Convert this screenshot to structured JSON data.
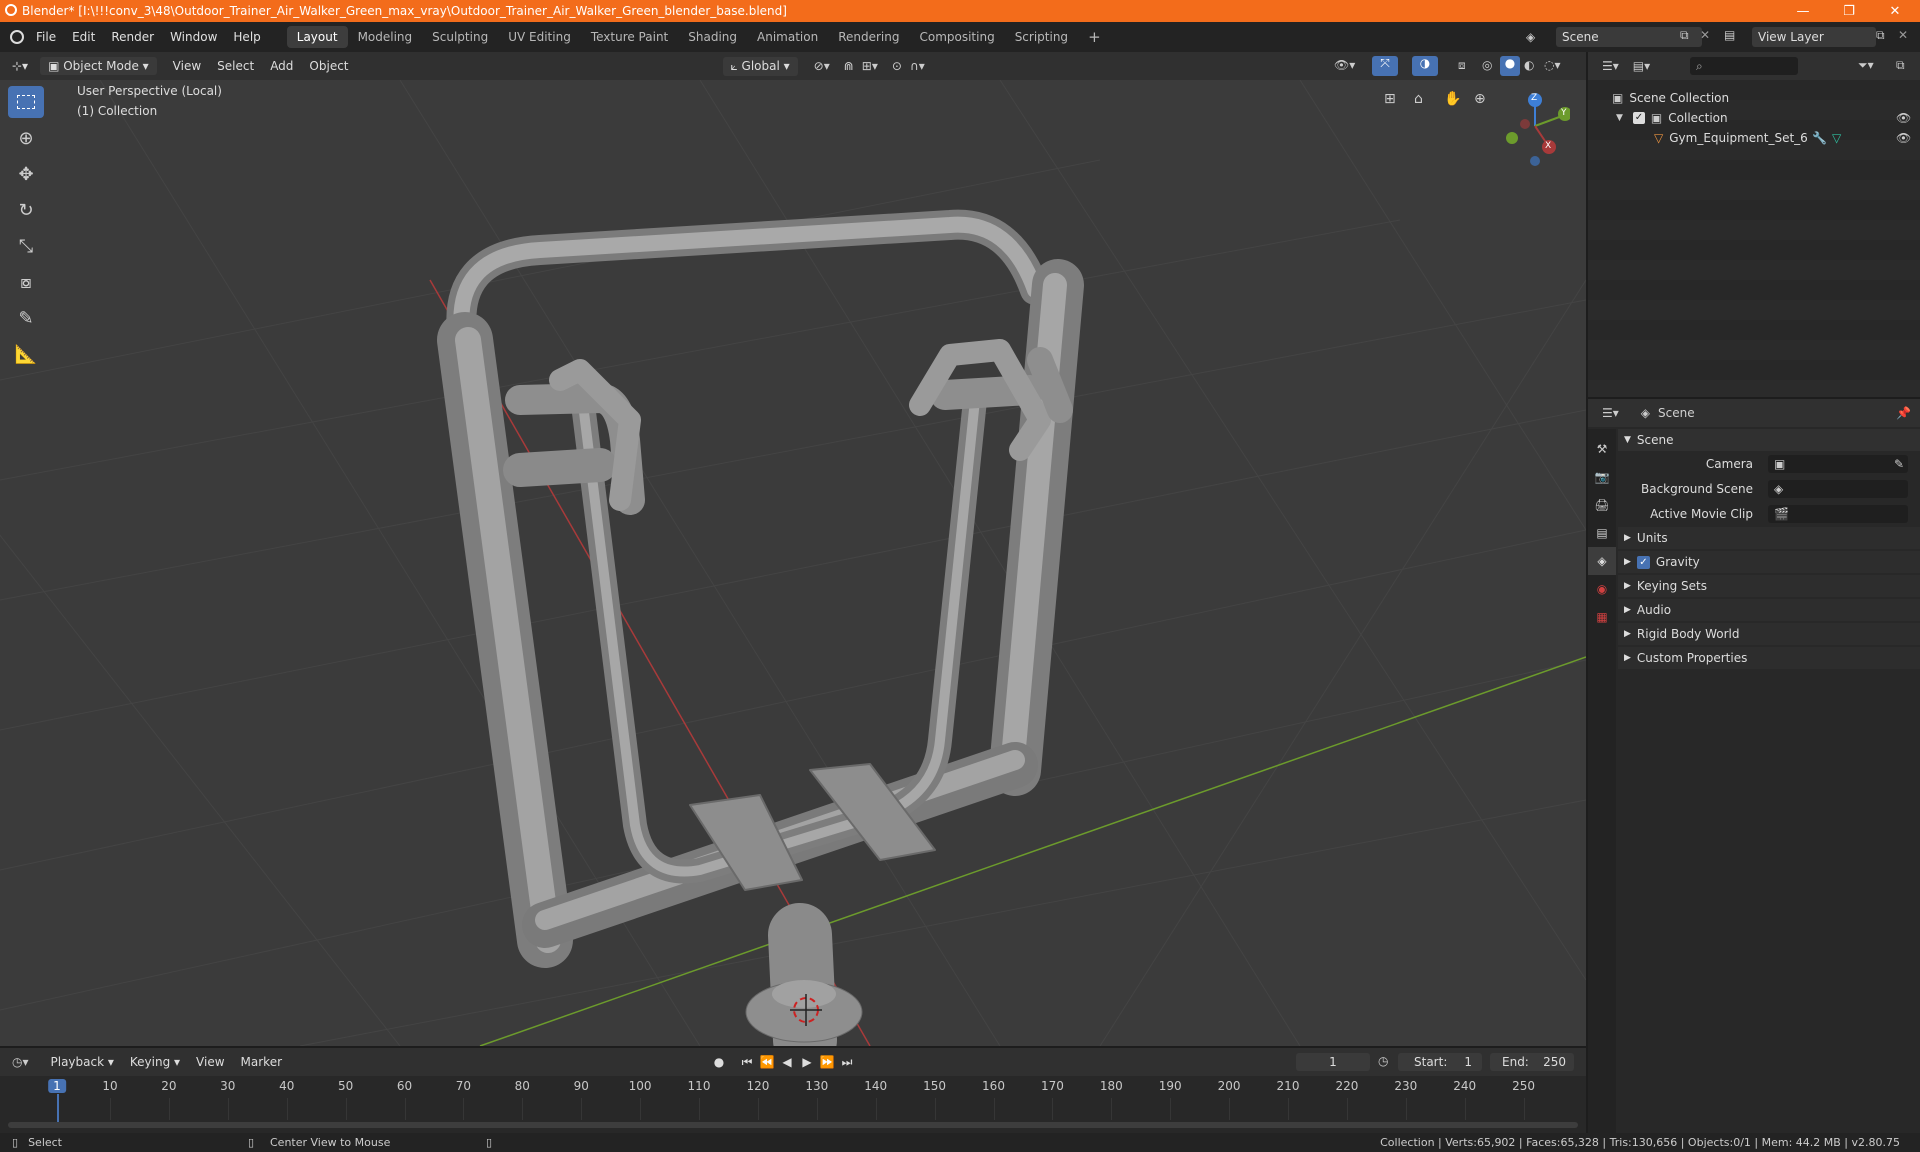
{
  "window": {
    "title": "Blender* [I:\\!!!conv_3\\48\\Outdoor_Trainer_Air_Walker_Green_max_vray\\Outdoor_Trainer_Air_Walker_Green_blender_base.blend]",
    "minimize": "—",
    "maximize": "❐",
    "close": "✕"
  },
  "menus": [
    "File",
    "Edit",
    "Render",
    "Window",
    "Help"
  ],
  "workspaces": [
    "Layout",
    "Modeling",
    "Sculpting",
    "UV Editing",
    "Texture Paint",
    "Shading",
    "Animation",
    "Rendering",
    "Compositing",
    "Scripting"
  ],
  "add_workspace": "+",
  "scene_field": "Scene",
  "view_layer_field": "View Layer",
  "viewport_header": {
    "mode": "Object Mode",
    "menus": [
      "View",
      "Select",
      "Add",
      "Object"
    ],
    "orientation": "Global"
  },
  "viewport": {
    "perspective": "User Perspective (Local)",
    "collection": "(1) Collection",
    "gizmo": {
      "z": "Z",
      "y": "Y",
      "x": "X"
    }
  },
  "tools": [
    "select-box",
    "cursor",
    "move",
    "rotate",
    "scale",
    "transform",
    "annotate",
    "measure"
  ],
  "outliner": {
    "scene_collection": "Scene Collection",
    "collection": "Collection",
    "object": "Gym_Equipment_Set_6"
  },
  "properties": {
    "header": "Scene",
    "panel_title": "Scene",
    "camera_label": "Camera",
    "background_scene_label": "Background Scene",
    "active_movie_clip_label": "Active Movie Clip",
    "sections": [
      "Units",
      "Gravity",
      "Keying Sets",
      "Audio",
      "Rigid Body World",
      "Custom Properties"
    ],
    "gravity_checked": true
  },
  "timeline": {
    "menus": [
      "Playback",
      "Keying",
      "View",
      "Marker"
    ],
    "current_frame": "1",
    "start_label": "Start:",
    "start": "1",
    "end_label": "End:",
    "end": "250",
    "ticks": [
      "1",
      "10",
      "20",
      "30",
      "40",
      "50",
      "60",
      "70",
      "80",
      "90",
      "100",
      "110",
      "120",
      "130",
      "140",
      "150",
      "160",
      "170",
      "180",
      "190",
      "200",
      "210",
      "220",
      "230",
      "240",
      "250"
    ]
  },
  "status": {
    "select": "Select",
    "center_view": "Center View to Mouse",
    "stats": "Collection | Verts:65,902 | Faces:65,328 | Tris:130,656 | Objects:0/1 | Mem: 44.2 MB | v2.80.75"
  },
  "colors": {
    "title_bar": "#f36c1b",
    "accent": "#4772b3",
    "x_axis": "#a83a3a",
    "y_axis": "#6c9b2c",
    "z_axis": "#3e7fd6"
  }
}
